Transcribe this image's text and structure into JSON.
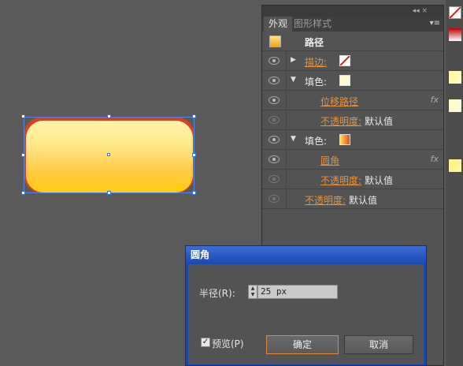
{
  "appearance_panel": {
    "top_bar": "◂◂ ×",
    "tabs": [
      "外观",
      "图形样式"
    ],
    "menu": "▾≡",
    "header_title": "路径",
    "rows": [
      {
        "label": "描边:",
        "kind": "link"
      },
      {
        "label": "填色:",
        "kind": "text"
      },
      {
        "label": "位移路径",
        "kind": "link",
        "fx": "fx"
      },
      {
        "label": "不透明度:",
        "kind": "link",
        "value": "默认值"
      },
      {
        "label": "填色:",
        "kind": "text"
      },
      {
        "label": "圆角",
        "kind": "link",
        "fx": "fx"
      },
      {
        "label": "不透明度:",
        "kind": "link",
        "value": "默认值"
      },
      {
        "label": "不透明度:",
        "kind": "link",
        "value": "默认值"
      }
    ]
  },
  "dialog": {
    "title": "圆角",
    "radius_label": "半径(R):",
    "radius_value": "25 px",
    "preview_label": "预览(P)",
    "preview_checked": "✓",
    "ok_label": "确定",
    "cancel_label": "取消"
  },
  "colors": {
    "accent_link": "#e6923c",
    "dialog_title": "#1a48b0",
    "shape_stroke": "#d9411f",
    "shape_fill_top": "#fff4a8",
    "shape_fill_bottom": "#ffcc10"
  }
}
